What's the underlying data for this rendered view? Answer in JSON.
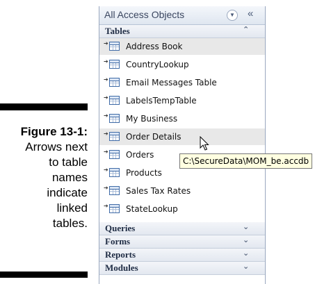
{
  "caption": {
    "figure_label": "Figure 13-1:",
    "text_lines": [
      "Arrows next",
      "to table",
      "names",
      "indicate",
      "linked",
      "tables."
    ]
  },
  "pane": {
    "title": "All Access Objects",
    "dropdown_icon": "chevron-down-icon",
    "shutter_icon": "double-chevron-left-icon",
    "shutter_glyph": "«",
    "tables_group": {
      "label": "Tables",
      "chevron": "⌃",
      "items": [
        {
          "label": "Address Book",
          "selected": true
        },
        {
          "label": "CountryLookup",
          "selected": false
        },
        {
          "label": "Email Messages Table",
          "selected": false
        },
        {
          "label": "LabelsTempTable",
          "selected": false
        },
        {
          "label": "My Business",
          "selected": false
        },
        {
          "label": "Order Details",
          "selected": true
        },
        {
          "label": "Orders",
          "selected": false
        },
        {
          "label": "Products",
          "selected": false
        },
        {
          "label": "Sales Tax Rates",
          "selected": false
        },
        {
          "label": "StateLookup",
          "selected": false
        }
      ]
    },
    "collapsed_groups": [
      {
        "label": "Queries",
        "chevron": "⌄"
      },
      {
        "label": "Forms",
        "chevron": "⌄"
      },
      {
        "label": "Reports",
        "chevron": "⌄"
      },
      {
        "label": "Modules",
        "chevron": "⌄"
      }
    ]
  },
  "tooltip": {
    "text": "C:\\SecureData\\MOM_be.accdb"
  },
  "colors": {
    "pane_border": "#9aa8bf",
    "selected_row": "#e8e8e8",
    "tooltip_bg": "#ffffe1"
  }
}
